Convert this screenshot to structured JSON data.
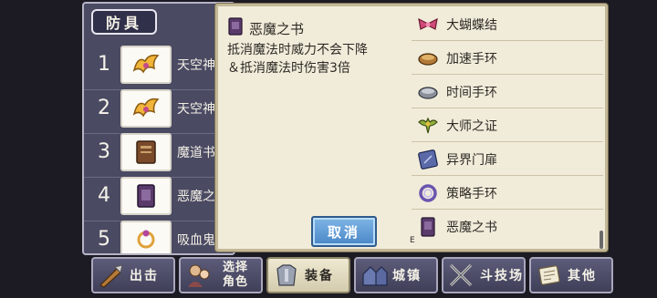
{
  "left_panel": {
    "tab_label": "防具",
    "rows": [
      {
        "num": "1",
        "label": "天空神",
        "icon": "sky-wing-icon"
      },
      {
        "num": "2",
        "label": "天空神",
        "icon": "sky-wing-icon"
      },
      {
        "num": "3",
        "label": "魔道书",
        "icon": "magic-book-icon"
      },
      {
        "num": "4",
        "label": "恶魔之",
        "icon": "demon-book-icon"
      },
      {
        "num": "5",
        "label": "吸血鬼",
        "icon": "vampire-ring-icon"
      }
    ]
  },
  "detail": {
    "title": "恶魔之书",
    "desc_line1": "抵消魔法时威力不会下降",
    "desc_line2": "＆抵消魔法时伤害3倍",
    "cancel_label": "取消"
  },
  "item_list": {
    "items": [
      {
        "label": "大蝴蝶结",
        "icon": "ribbon-icon"
      },
      {
        "label": "加速手环",
        "icon": "speed-bracelet-icon"
      },
      {
        "label": "时间手环",
        "icon": "time-bracelet-icon"
      },
      {
        "label": "大师之证",
        "icon": "master-emblem-icon"
      },
      {
        "label": "异界门扉",
        "icon": "portal-card-icon"
      },
      {
        "label": "策略手环",
        "icon": "strategy-bracelet-icon"
      },
      {
        "label": "恶魔之书",
        "icon": "demon-book-icon"
      }
    ],
    "equipped_mark": "E"
  },
  "bottom_nav": {
    "items": [
      {
        "label": "出击",
        "icon": "sortie-icon"
      },
      {
        "label": "选择角色",
        "line1": "选择",
        "line2": "角色",
        "icon": "character-select-icon"
      },
      {
        "label": "装备",
        "icon": "armor-icon",
        "active": true
      },
      {
        "label": "城镇",
        "icon": "town-icon"
      },
      {
        "label": "斗技场",
        "icon": "arena-icon"
      },
      {
        "label": "其他",
        "icon": "scroll-icon"
      }
    ]
  },
  "colors": {
    "panel_bg": "#4a4a63",
    "popup_bg": "#f1ecda",
    "cancel_button": "#4a86c8",
    "nav_active": "#efe9d2"
  }
}
